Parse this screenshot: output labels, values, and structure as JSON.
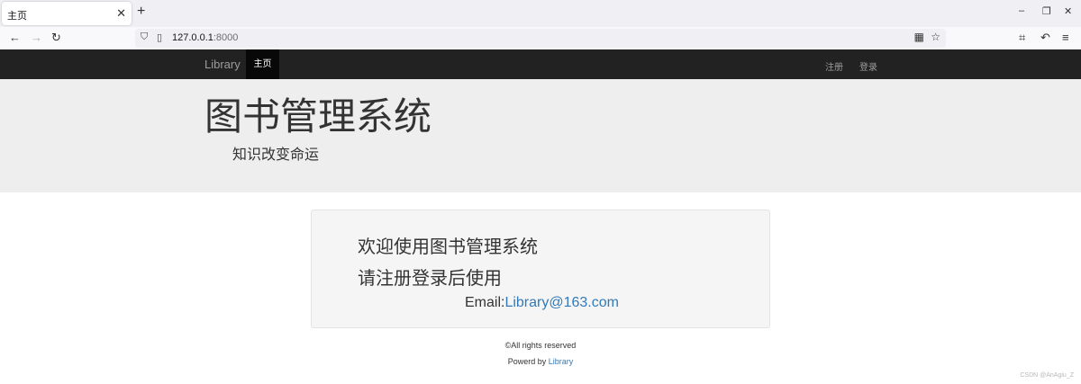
{
  "browser": {
    "tab_title": "主页",
    "tab_close": "✕",
    "new_tab": "+",
    "window_controls": {
      "minimize": "–",
      "restore": "❐",
      "close": "✕"
    },
    "nav": {
      "back": "←",
      "forward": "→",
      "reload": "↻"
    },
    "url_host": "127.0.0.1",
    "url_port": ":8000",
    "toolbar_icons": [
      "crop-icon",
      "undo-icon",
      "menu-icon"
    ]
  },
  "site_nav": {
    "brand": "Library",
    "active_item": "主页",
    "right_items": [
      "注册",
      "登录"
    ],
    "bg_color": "#222222"
  },
  "jumbotron": {
    "title": "图书管理系统",
    "subtitle": "知识改变命运"
  },
  "welcome": {
    "line1": "欢迎使用图书管理系统",
    "line2": "请注册登录后使用",
    "email_label": "Email:",
    "email_value": "Library@163.com"
  },
  "footer": {
    "rights": "©All rights reserved",
    "powered_prefix": "Powerd by ",
    "powered_link": "Library"
  },
  "watermark": "CSDN @AnAgiu_Z",
  "colors": {
    "link": "#337ab7",
    "jumbotron_bg": "#eeeeee"
  }
}
